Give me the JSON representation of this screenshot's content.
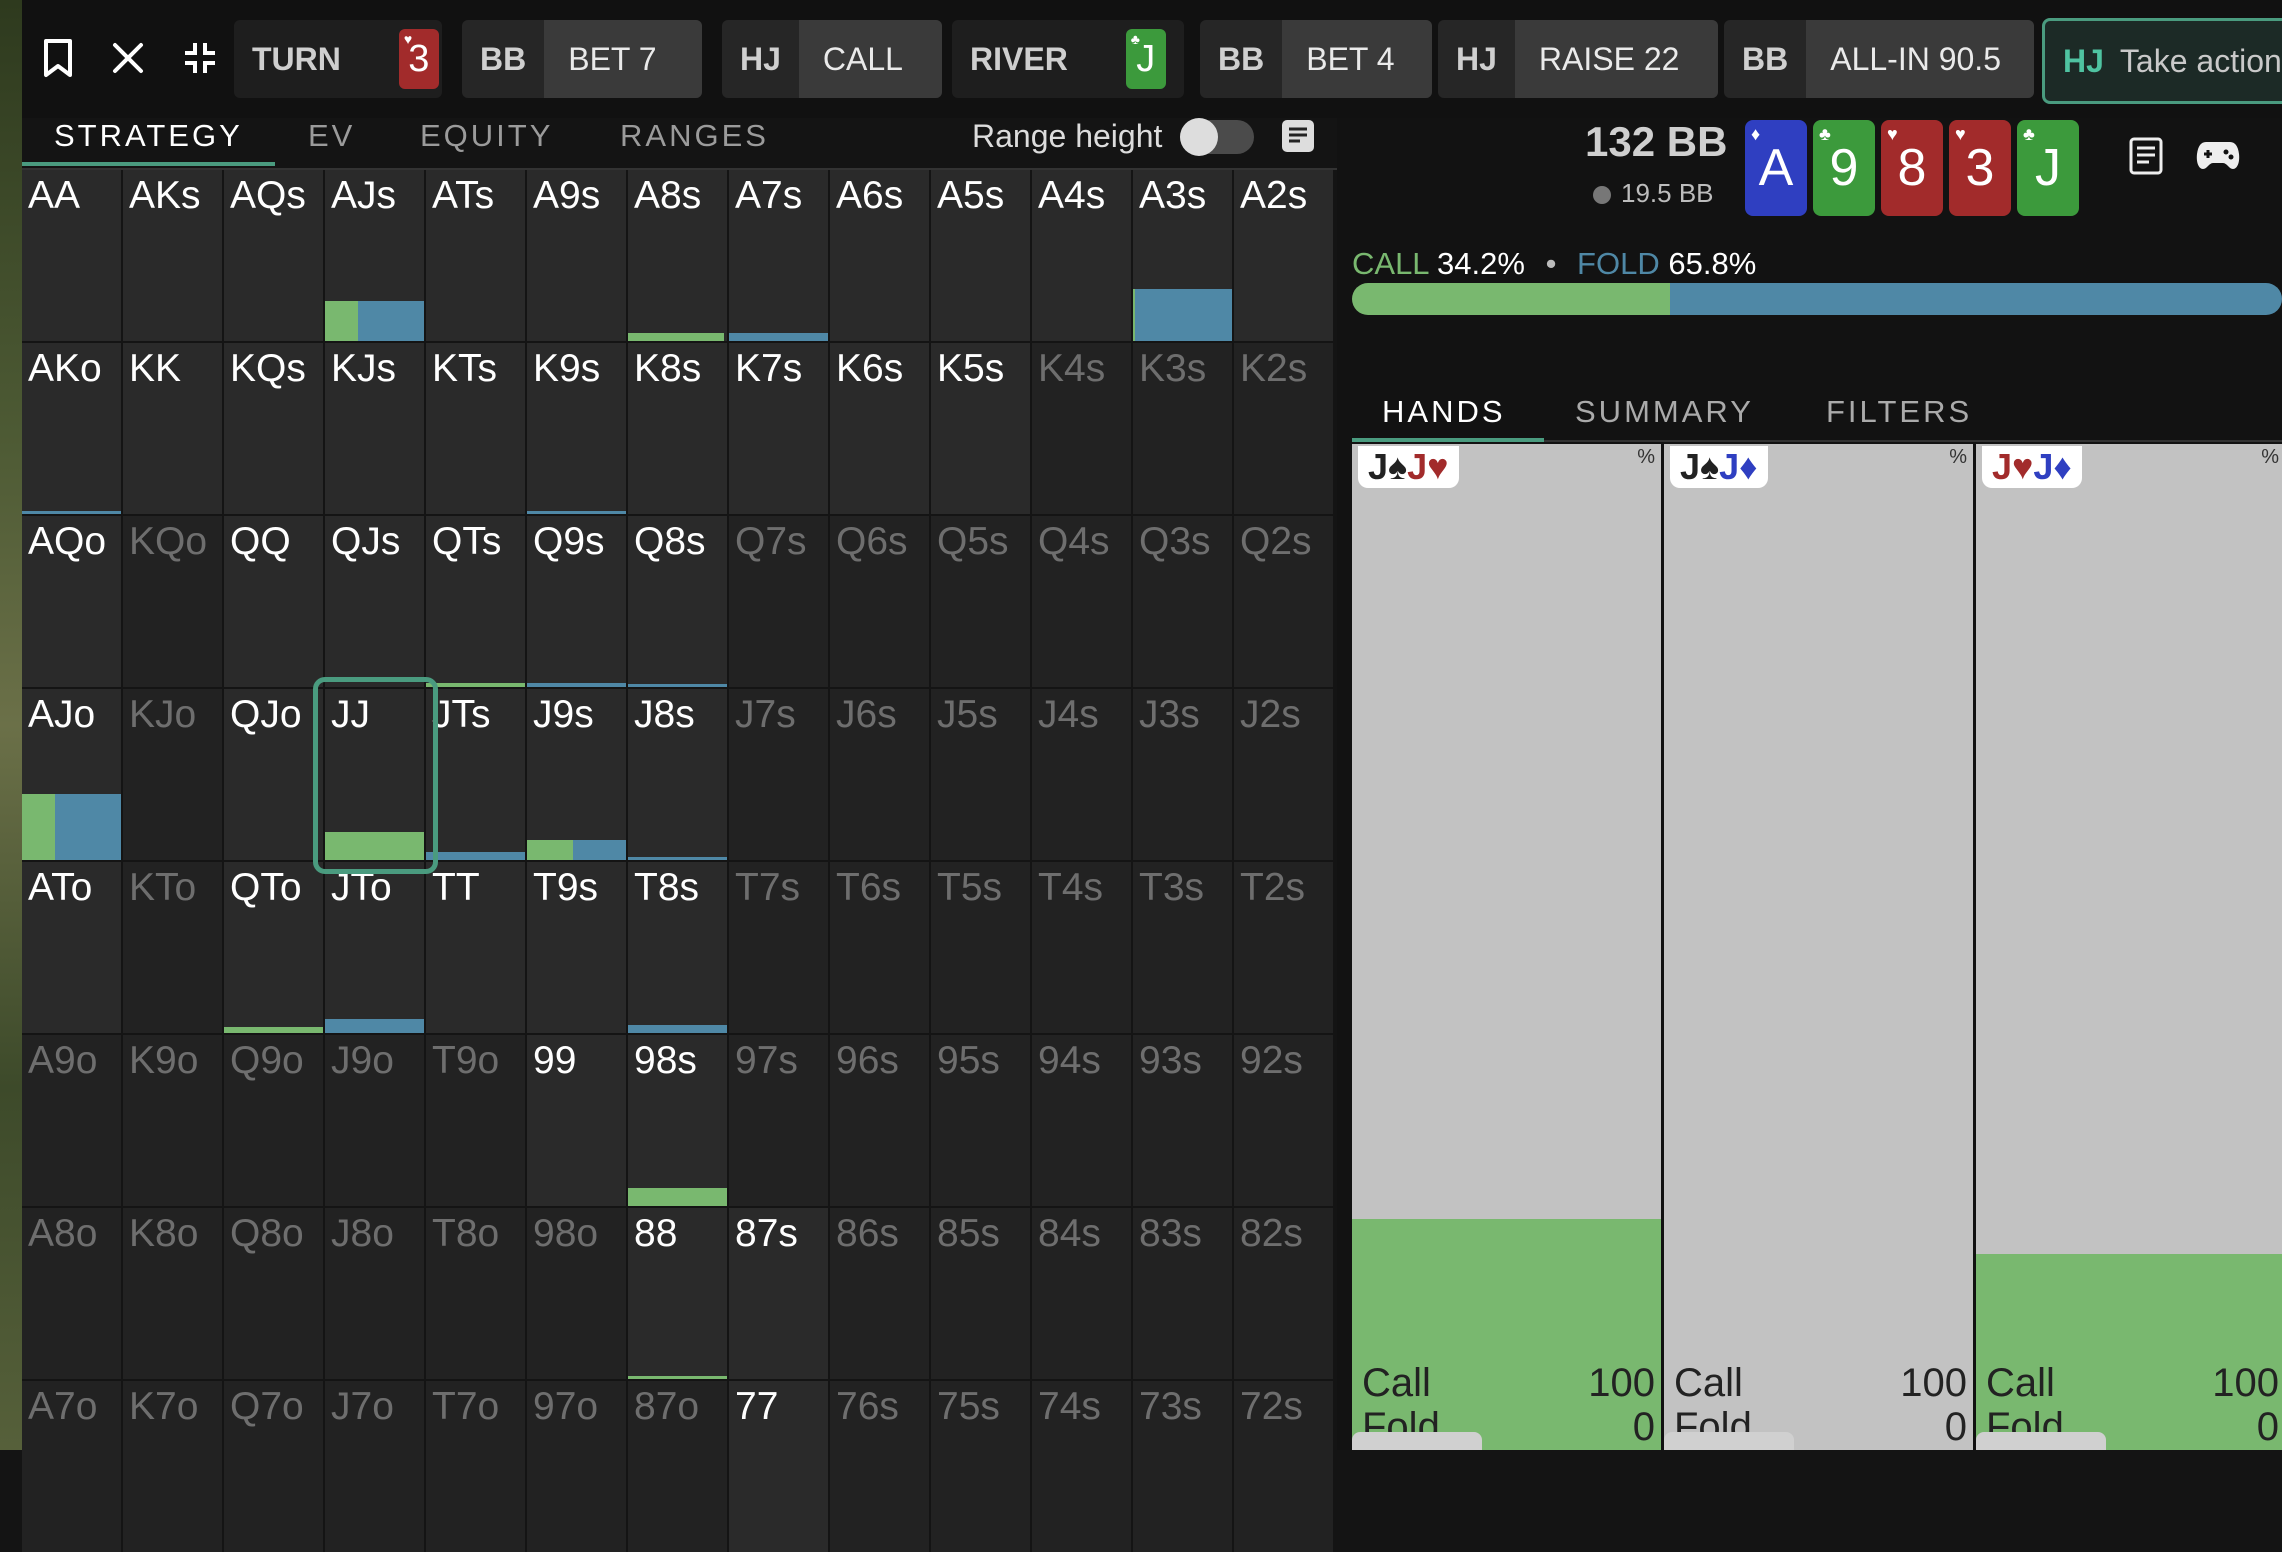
{
  "colors": {
    "call": "#79b86f",
    "fold": "#4f88a6",
    "accent": "#4a9b7f",
    "red_card": "#a22b2b",
    "green_card": "#3c9a3c",
    "blue_card": "#2f3fc1"
  },
  "toolbar": {
    "icons": [
      "bookmark-icon",
      "close-icon",
      "collapse-icon"
    ],
    "streets": {
      "turn": "TURN",
      "river": "RIVER"
    },
    "turn_card": {
      "rank": "3",
      "suit": "♥"
    },
    "river_card": {
      "rank": "J",
      "suit": "♣"
    },
    "actions": [
      {
        "pos": "BB",
        "action": "BET 7"
      },
      {
        "pos": "HJ",
        "action": "CALL"
      },
      {
        "pos": "BB",
        "action": "BET 4"
      },
      {
        "pos": "HJ",
        "action": "RAISE 22"
      },
      {
        "pos": "BB",
        "action": "ALL-IN 90.5"
      }
    ],
    "take_action": {
      "pos": "HJ",
      "label": "Take action"
    }
  },
  "left_tabs": [
    "STRATEGY",
    "EV",
    "EQUITY",
    "RANGES"
  ],
  "range_height_label": "Range height",
  "grid": {
    "rows": [
      [
        "AA",
        "AKs",
        "AQs",
        "AJs",
        "ATs",
        "A9s",
        "A8s",
        "A7s",
        "A6s",
        "A5s",
        "A4s",
        "A3s",
        "A2s"
      ],
      [
        "AKo",
        "KK",
        "KQs",
        "KJs",
        "KTs",
        "K9s",
        "K8s",
        "K7s",
        "K6s",
        "K5s",
        "K4s",
        "K3s",
        "K2s"
      ],
      [
        "AQo",
        "KQo",
        "QQ",
        "QJs",
        "QTs",
        "Q9s",
        "Q8s",
        "Q7s",
        "Q6s",
        "Q5s",
        "Q4s",
        "Q3s",
        "Q2s"
      ],
      [
        "AJo",
        "KJo",
        "QJo",
        "JJ",
        "JTs",
        "J9s",
        "J8s",
        "J7s",
        "J6s",
        "J5s",
        "J4s",
        "J3s",
        "J2s"
      ],
      [
        "ATo",
        "KTo",
        "QTo",
        "JTo",
        "TT",
        "T9s",
        "T8s",
        "T7s",
        "T6s",
        "T5s",
        "T4s",
        "T3s",
        "T2s"
      ],
      [
        "A9o",
        "K9o",
        "Q9o",
        "J9o",
        "T9o",
        "99",
        "98s",
        "97s",
        "96s",
        "95s",
        "94s",
        "93s",
        "92s"
      ],
      [
        "A8o",
        "K8o",
        "Q8o",
        "J8o",
        "T8o",
        "98o",
        "88",
        "87s",
        "86s",
        "85s",
        "84s",
        "83s",
        "82s"
      ],
      [
        "A7o",
        "K7o",
        "Q7o",
        "J7o",
        "T7o",
        "97o",
        "87o",
        "77",
        "76s",
        "75s",
        "74s",
        "73s",
        "72s"
      ]
    ],
    "dim": [
      [],
      [
        10,
        11,
        12
      ],
      [
        1,
        7,
        8,
        9,
        10,
        11,
        12
      ],
      [
        1,
        7,
        8,
        9,
        10,
        11,
        12
      ],
      [
        1,
        7,
        8,
        9,
        10,
        11,
        12
      ],
      [
        0,
        1,
        2,
        3,
        4,
        7,
        8,
        9,
        10,
        11,
        12
      ],
      [
        0,
        1,
        2,
        3,
        4,
        5,
        8,
        9,
        10,
        11,
        12
      ],
      [
        0,
        1,
        2,
        3,
        4,
        5,
        6,
        8,
        9,
        10,
        11,
        12
      ]
    ],
    "selected": {
      "row": 3,
      "col": 3
    }
  },
  "header": {
    "stack": "132 BB",
    "pot": "19.5 BB"
  },
  "board": [
    {
      "rank": "A",
      "suit": "♦",
      "color": "blue"
    },
    {
      "rank": "9",
      "suit": "♣",
      "color": "green"
    },
    {
      "rank": "8",
      "suit": "♥",
      "color": "red"
    },
    {
      "rank": "3",
      "suit": "♥",
      "color": "red"
    },
    {
      "rank": "J",
      "suit": "♣",
      "color": "green"
    }
  ],
  "right_icons": [
    "notes-icon",
    "gamepad-icon"
  ],
  "strategy": {
    "call_label": "CALL",
    "call_pct": "34.2%",
    "fold_label": "FOLD",
    "fold_pct": "65.8%",
    "call_fraction": 0.342,
    "dot": "•"
  },
  "right_tabs": [
    "HANDS",
    "SUMMARY",
    "FILTERS"
  ],
  "hands": [
    {
      "combo": [
        {
          "r": "J",
          "s": "♠",
          "c": "#222"
        },
        {
          "r": "J",
          "s": "♥",
          "c": "#a22b2b"
        }
      ],
      "pct": "%",
      "call_label": "Call",
      "call": "100",
      "fold_label": "Fold",
      "fold": "0",
      "call_fraction": 0.23
    },
    {
      "combo": [
        {
          "r": "J",
          "s": "♠",
          "c": "#222"
        },
        {
          "r": "J",
          "s": "♦",
          "c": "#2f3fc1"
        }
      ],
      "pct": "%",
      "call_label": "Call",
      "call": "100",
      "fold_label": "Fold",
      "fold": "0",
      "call_fraction": 0.0
    },
    {
      "combo": [
        {
          "r": "J",
          "s": "♥",
          "c": "#a22b2b"
        },
        {
          "r": "J",
          "s": "♦",
          "c": "#2f3fc1"
        }
      ],
      "pct": "%",
      "call_label": "Call",
      "call": "100",
      "fold_label": "Fold",
      "fold": "0",
      "call_fraction": 0.195
    }
  ]
}
